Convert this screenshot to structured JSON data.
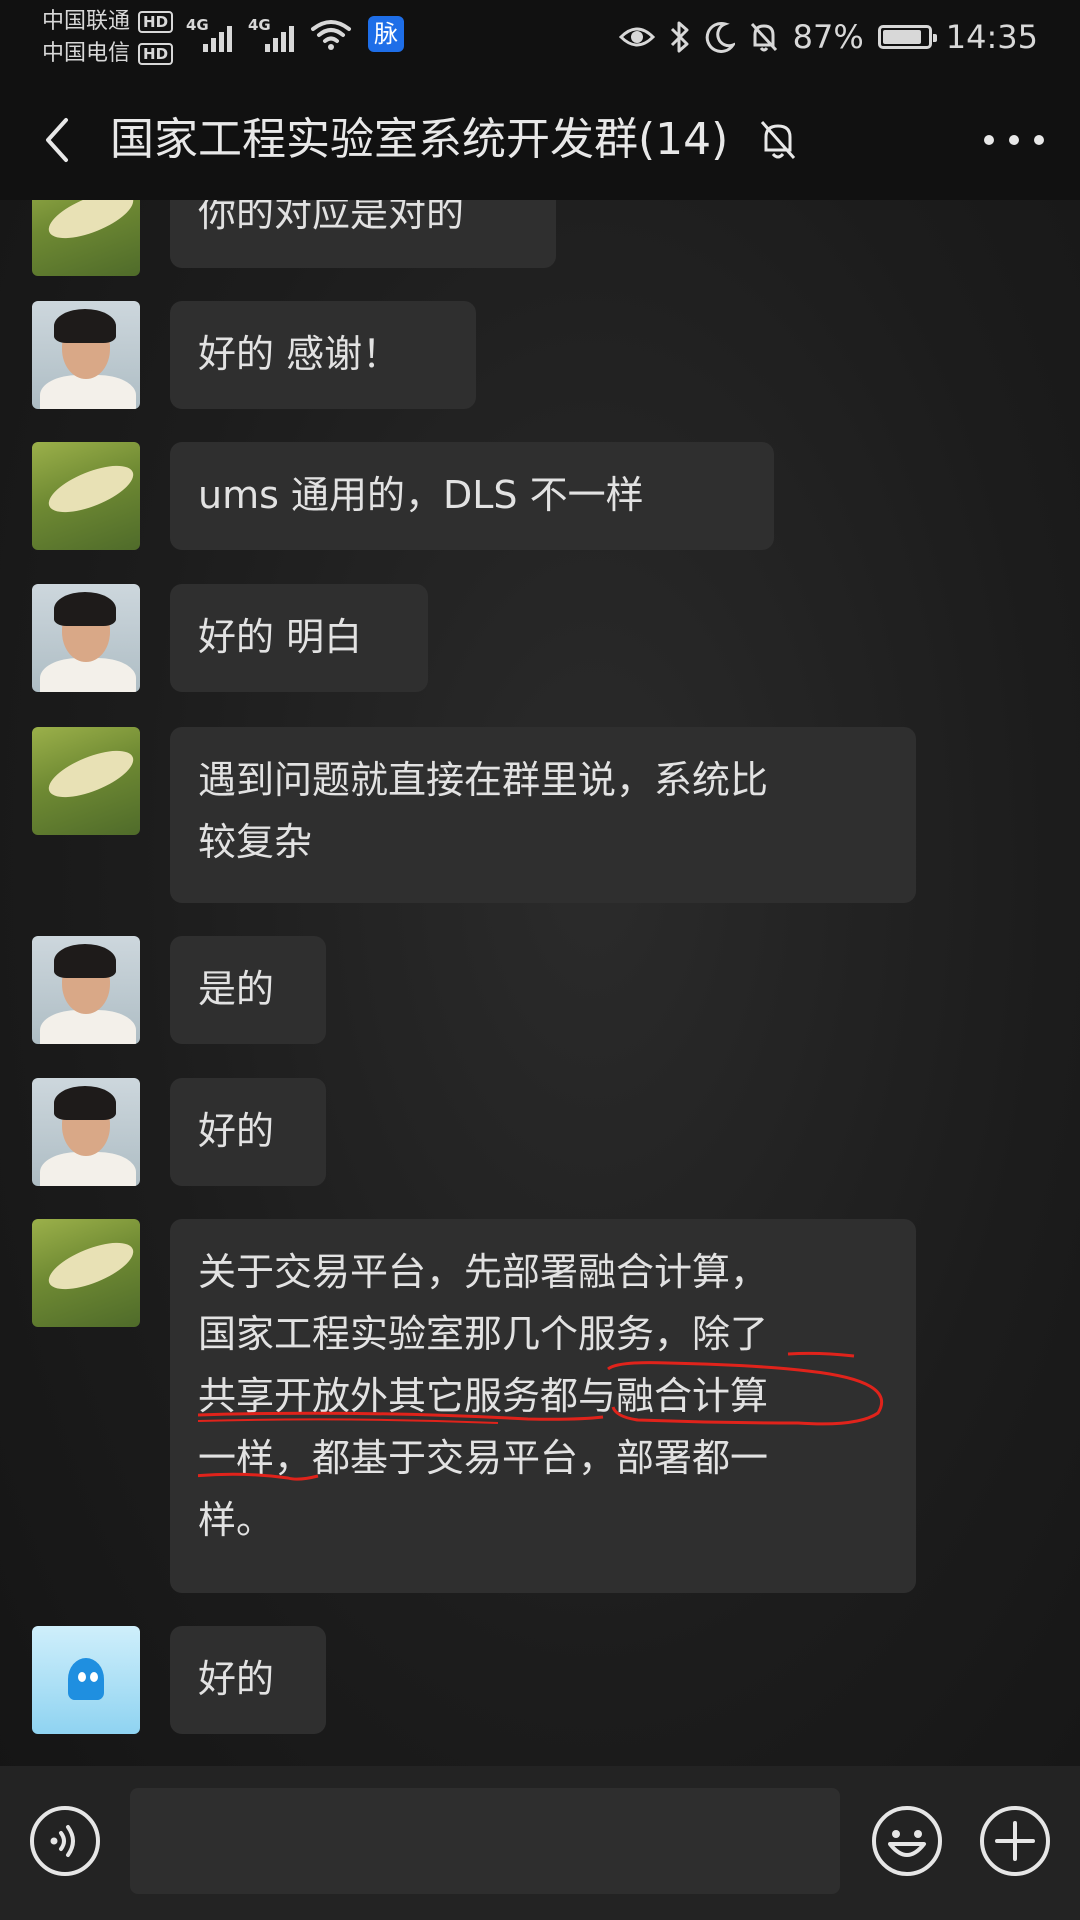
{
  "status_bar": {
    "carrier_1": "中国联通",
    "carrier_2": "中国电信",
    "hd": "HD",
    "net_1": "4G",
    "net_2": "4G",
    "app_badge": "脉",
    "battery": "87%",
    "battery_level": 0.87,
    "time": "14:35",
    "icons": [
      "eye-icon",
      "bluetooth-icon",
      "moon-icon",
      "bell-off-icon",
      "wifi-icon",
      "signal-icon"
    ]
  },
  "header": {
    "title": "国家工程实验室系统开发群(14)",
    "icons": [
      "back-arrow-icon",
      "mute-bell-icon",
      "more-dots-icon"
    ]
  },
  "messages": [
    {
      "sender": "field",
      "text": "你的对应是对的"
    },
    {
      "sender": "person",
      "text": "好的 感谢！"
    },
    {
      "sender": "field",
      "text": "ums 通用的，DLS 不一样"
    },
    {
      "sender": "person",
      "text": "好的 明白"
    },
    {
      "sender": "field",
      "lines": [
        "遇到问题就直接在群里说，系统比",
        "较复杂"
      ]
    },
    {
      "sender": "person",
      "text": "是的"
    },
    {
      "sender": "person",
      "text": "好的"
    },
    {
      "sender": "field",
      "lines": [
        "关于交易平台，先部署融合计算，",
        "国家工程实验室那几个服务，除了",
        "共享开放外其它服务都与融合计算",
        "一样，都基于交易平台，部署都一",
        "样。"
      ]
    },
    {
      "sender": "qq",
      "text": "好的"
    }
  ],
  "colors": {
    "bubble": "#2f2f2f",
    "annotation_red": "#e0231b",
    "app_badge": "#1e6ee8"
  },
  "input_bar": {
    "placeholder": "",
    "icons": [
      "voice-icon",
      "emoji-icon",
      "plus-icon"
    ]
  }
}
